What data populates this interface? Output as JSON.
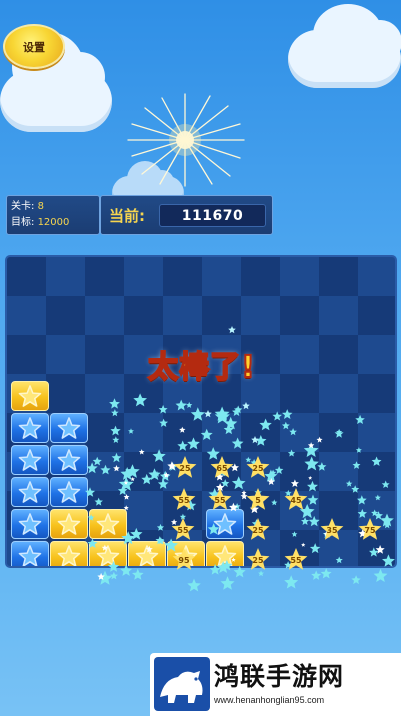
{
  "settings": {
    "label": "设置"
  },
  "level": {
    "label": "关卡:",
    "value": "8"
  },
  "target": {
    "label": "目标:",
    "value": "12000"
  },
  "score": {
    "label": "当前:",
    "value": "111670"
  },
  "praise_text": "太棒了!",
  "floating_scores": [
    "25",
    "65",
    "25",
    "55",
    "5",
    "45",
    "55",
    "55",
    "25",
    "35",
    "75",
    "95",
    "25",
    "55"
  ],
  "watermark": {
    "title": "鸿联手游网",
    "url": "www.henanhonglian95.com"
  },
  "colors": {
    "tile_blue": "#1f72e6",
    "tile_yellow": "#f7c21c",
    "score_label": "#f6d54f",
    "praise_fill": "#ffd22e",
    "particle": "#7de8f0"
  },
  "icons": [
    "star-icon",
    "sparkle-icon",
    "bison-logo-icon"
  ]
}
